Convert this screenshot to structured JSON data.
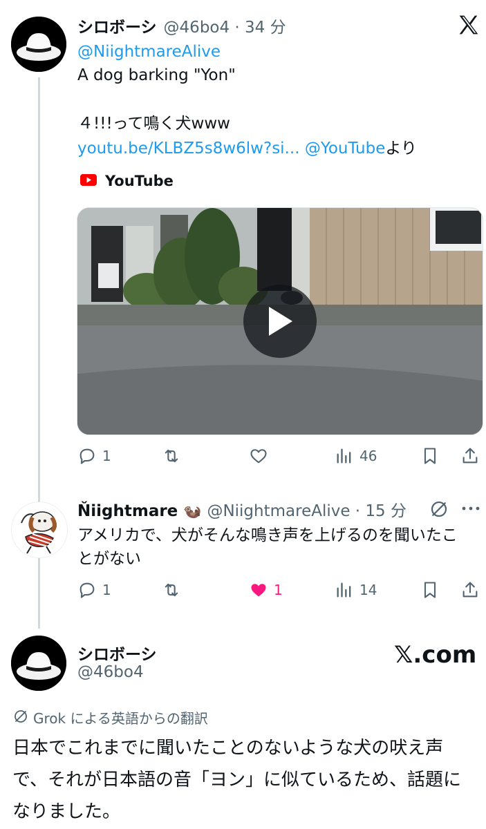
{
  "tweet1": {
    "name": "シロボーシ",
    "handle_time": "@46bo4 · 34 分",
    "mention": "@NiightmareAlive",
    "line1": "A dog barking \"Yon\"",
    "line2": "４!!!って鳴く犬www",
    "link": "youtu.be/KLBZ5s8w6lw?si...",
    "link_mention": "@YouTube",
    "link_suffix": "より",
    "card_source": "YouTube",
    "stats": {
      "replies": "1",
      "likes": "",
      "views": "46"
    }
  },
  "tweet2": {
    "name": "Ňiightmare",
    "emoji": "🦦",
    "handle_time": "@NiightmareAlive · 15 分",
    "text": "アメリカで、犬がそんな鳴き声を上げるのを聞いたことがない",
    "stats": {
      "replies": "1",
      "likes": "1",
      "views": "14"
    }
  },
  "tweet3": {
    "name": "シロボーシ",
    "handle": "@46bo4",
    "brand": "𝕏.com",
    "translation_label": "Grok による英語からの翻訳",
    "text": "日本でこれまでに聞いたことのないような犬の吠え声で、それが日本語の音「ヨン」に似ているため、話題になりました。"
  },
  "colors": {
    "link": "#1d9bf0",
    "like": "#f91880",
    "youtube": "#ff0000",
    "muted": "#536471"
  },
  "icons": [
    "x-logo-icon",
    "reply-icon",
    "retweet-icon",
    "like-icon",
    "views-icon",
    "bookmark-icon",
    "share-icon",
    "grok-icon",
    "more-icon",
    "play-icon",
    "youtube-icon"
  ]
}
